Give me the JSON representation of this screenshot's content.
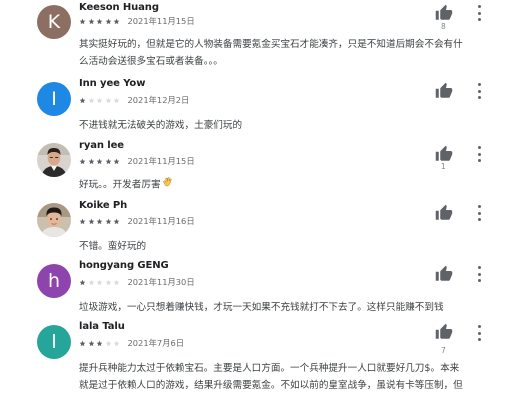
{
  "reviews": [
    {
      "name": "Keeson Huang",
      "avatar_letter": "K",
      "avatar_color": "#8d6e63",
      "rating": 5,
      "date": "2021年11月15日",
      "helpful_count": "8",
      "body_lines": [
        "其实挺好玩的，但就是它的人物装备需要氪金买宝石才能凑齐，只是不知道后期会不会有什",
        "么活动会送很多宝石或者装备。。。"
      ]
    },
    {
      "name": "Inn yee Yow",
      "avatar_letter": "I",
      "avatar_color": "#1e88e5",
      "rating": 1,
      "date": "2021年12月2日",
      "helpful_count": "",
      "body_lines": [
        "不进钱就无法破关的游戏，土豪们玩的"
      ]
    },
    {
      "name": "ryan lee",
      "avatar_letter": "",
      "avatar_color": "#b0a9a2",
      "rating": 5,
      "date": "2021年11月15日",
      "helpful_count": "1",
      "body_lines": [
        "好玩。。开发者厉害"
      ]
    },
    {
      "name": "Koike Ph",
      "avatar_letter": "",
      "avatar_color": "#c9b8a8",
      "rating": 5,
      "date": "2021年11月16日",
      "helpful_count": "",
      "body_lines": [
        "不错。蛮好玩的"
      ]
    },
    {
      "name": "hongyang GENG",
      "avatar_letter": "h",
      "avatar_color": "#8e44ad",
      "rating": 1,
      "date": "2021年11月30日",
      "helpful_count": "",
      "body_lines": [
        "垃圾游戏，一心只想着赚快钱，才玩一天如果不充钱就打不下去了。这样只能赚不到钱"
      ]
    },
    {
      "name": "lala Talu",
      "avatar_letter": "l",
      "avatar_color": "#26a69a",
      "rating": 3,
      "date": "2021年7月6日",
      "helpful_count": "7",
      "body_lines": [
        "提升兵种能力太过于依赖宝石。主要是人口方面。一个兵种提升一人口就要好几刀$。本来",
        "就是过于依赖人口的游戏，结果升级需要氪金。不如以前的皇室战争，虽说有卡等压制，但"
      ]
    }
  ],
  "icons": {
    "helpful": "thumbs-up-icon",
    "more": "more-vert-icon",
    "star": "star-icon",
    "emoji": "clapping-hands-icon"
  },
  "colors": {
    "star_filled": "#5f6368",
    "star_empty": "#dadce0",
    "thumb": "#5f6368"
  }
}
